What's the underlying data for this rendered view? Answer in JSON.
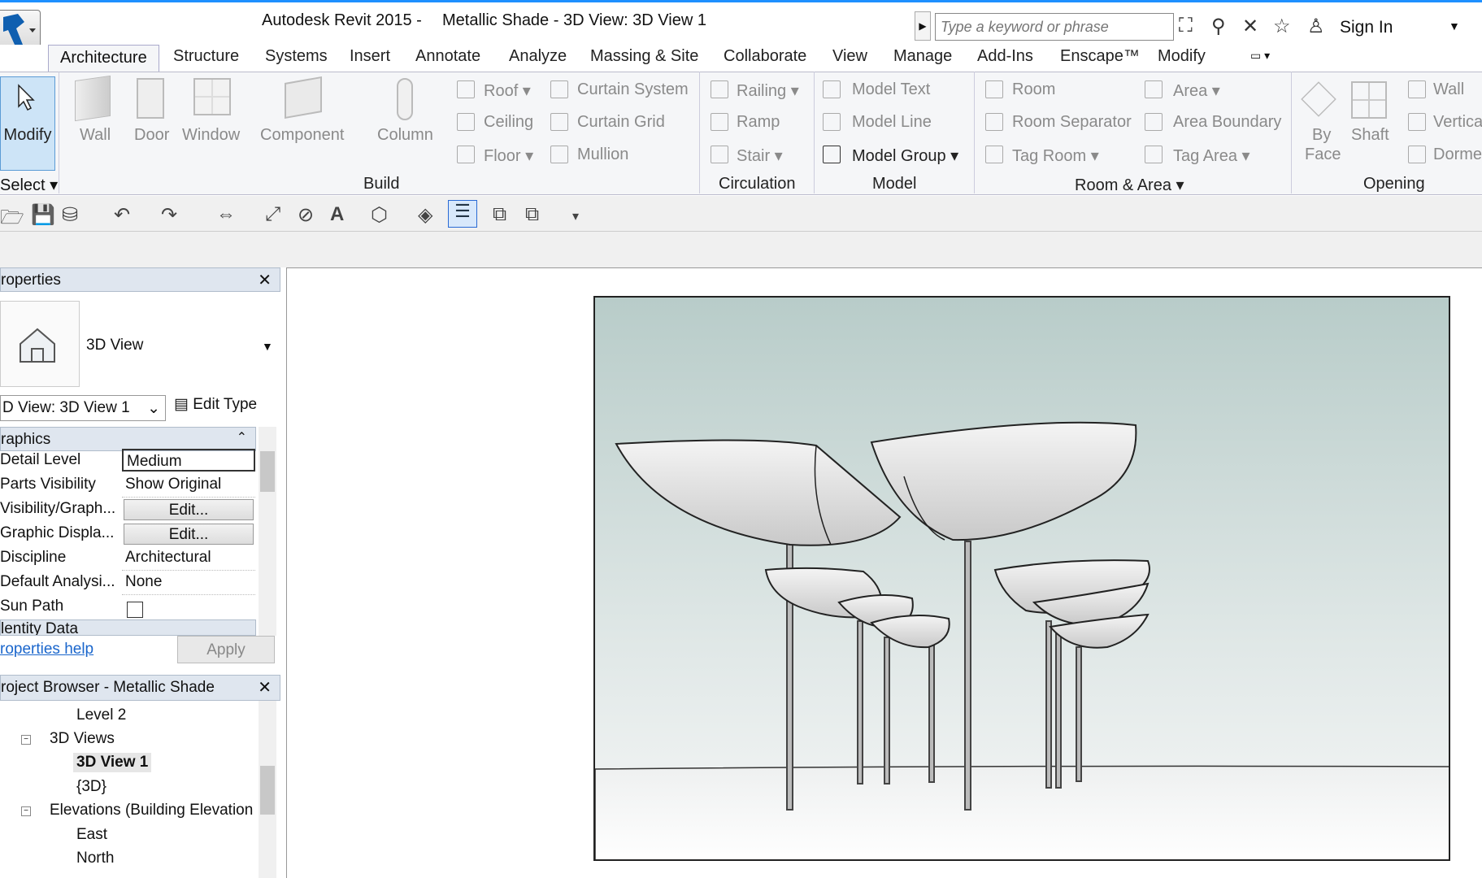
{
  "titlebar": {
    "app_title": "Autodesk Revit 2015 -",
    "doc_title": "Metallic Shade - 3D View: 3D View 1",
    "search_placeholder": "Type a keyword or phrase",
    "sign_in": "Sign In"
  },
  "tabs": [
    "Architecture",
    "Structure",
    "Systems",
    "Insert",
    "Annotate",
    "Analyze",
    "Massing & Site",
    "Collaborate",
    "View",
    "Manage",
    "Add-Ins",
    "Enscape™",
    "Modify"
  ],
  "ribbon": {
    "modify": "Modify",
    "select": "Select",
    "build": {
      "title": "Build",
      "large": [
        "Wall",
        "Door",
        "Window",
        "Component",
        "Column"
      ],
      "small": [
        "Roof",
        "Ceiling",
        "Floor",
        "Curtain System",
        "Curtain Grid",
        "Mullion"
      ]
    },
    "circulation": {
      "title": "Circulation",
      "items": [
        "Railing",
        "Ramp",
        "Stair"
      ]
    },
    "model": {
      "title": "Model",
      "items": [
        "Model Text",
        "Model Line",
        "Model Group"
      ]
    },
    "room_area": {
      "title": "Room & Area",
      "items": [
        "Room",
        "Room Separator",
        "Tag Room",
        "Area",
        "Area Boundary",
        "Tag Area"
      ]
    },
    "opening": {
      "title": "Opening",
      "by_face_1": "By",
      "by_face_2": "Face",
      "shaft": "Shaft",
      "items": [
        "Wall",
        "Vertical",
        "Dorme"
      ]
    }
  },
  "properties": {
    "title": "roperties",
    "type_name": "3D View",
    "view_selector": "D View: 3D View 1",
    "edit_type": "Edit Type",
    "section_graphics": "raphics",
    "rows": [
      {
        "key": "Detail Level",
        "value": "Medium"
      },
      {
        "key": "Parts Visibility",
        "value": "Show Original"
      },
      {
        "key": "Visibility/Graph...",
        "value": "Edit..."
      },
      {
        "key": "Graphic Displa...",
        "value": "Edit..."
      },
      {
        "key": "Discipline",
        "value": "Architectural"
      },
      {
        "key": "Default Analysi...",
        "value": "None"
      },
      {
        "key": "Sun Path",
        "value": ""
      }
    ],
    "section_identity": "lentity Data",
    "help_link": "roperties help",
    "apply": "Apply"
  },
  "project_browser": {
    "title": "roject Browser - Metallic Shade",
    "items": [
      "Level 2",
      "3D Views",
      "3D View 1",
      "{3D}",
      "Elevations (Building Elevation",
      "East",
      "North"
    ]
  },
  "colors": {
    "accent": "#1e90ff",
    "selected_tab_bg": "#f5f6f8",
    "link": "#1a66cc"
  }
}
